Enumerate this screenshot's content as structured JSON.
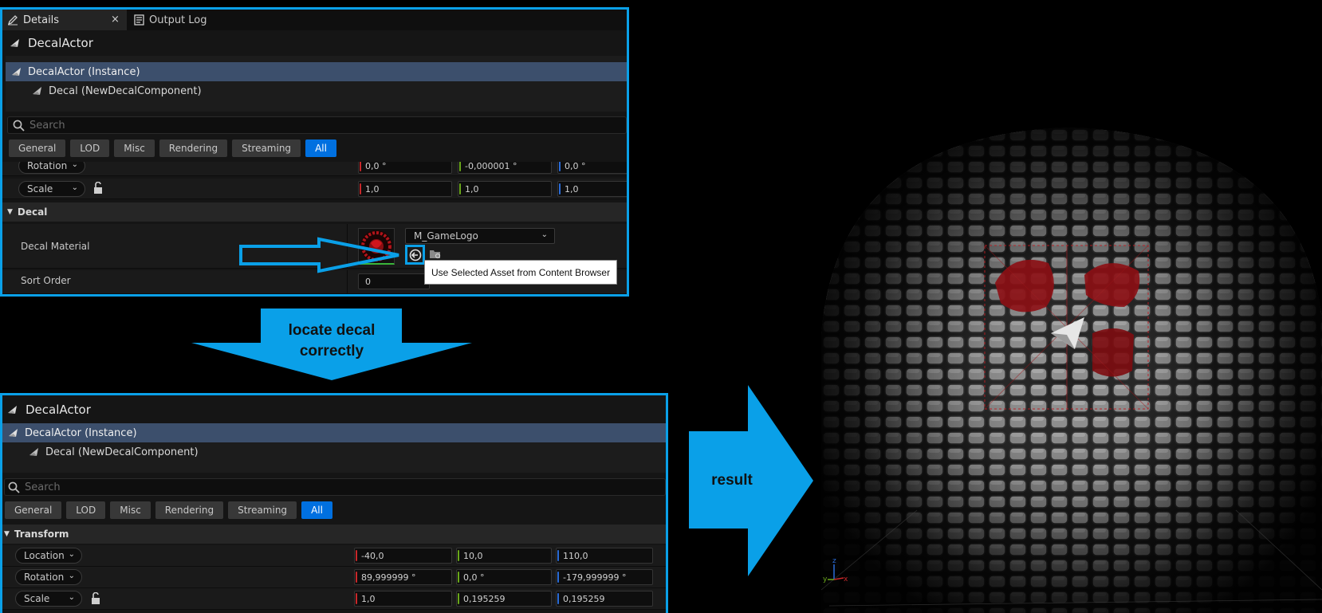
{
  "tabs": [
    {
      "label": "Details"
    },
    {
      "label": "Output Log"
    }
  ],
  "tab_close": "×",
  "panel1": {
    "actor_title": "DecalActor",
    "tree": [
      {
        "label": "DecalActor (Instance)"
      },
      {
        "label": "Decal (NewDecalComponent)"
      }
    ],
    "search_placeholder": "Search",
    "filters": [
      "General",
      "LOD",
      "Misc",
      "Rendering",
      "Streaming",
      "All"
    ],
    "rotation_label": "Rotation",
    "rotation_values": [
      "0,0 °",
      "-0,000001 °",
      "0,0 °"
    ],
    "scale_label": "Scale",
    "scale_values": [
      "1,0",
      "1,0",
      "1,0"
    ],
    "decal_section": "Decal",
    "decal_material_label": "Decal Material",
    "decal_material_value": "M_GameLogo",
    "sort_order_label": "Sort Order",
    "sort_order_value": "0"
  },
  "tooltip": "Use Selected Asset from Content Browser",
  "arrow1_label": "locate decal correctly",
  "arrow2_label": "result",
  "panel2": {
    "actor_title": "DecalActor",
    "tree": [
      {
        "label": "DecalActor (Instance)"
      },
      {
        "label": "Decal (NewDecalComponent)"
      }
    ],
    "search_placeholder": "Search",
    "filters": [
      "General",
      "LOD",
      "Misc",
      "Rendering",
      "Streaming",
      "All"
    ],
    "transform_section": "Transform",
    "location_label": "Location",
    "location_values": [
      "-40,0",
      "10,0",
      "110,0"
    ],
    "rotation_label": "Rotation",
    "rotation_values": [
      "89,999999 °",
      "0,0 °",
      "-179,999999 °"
    ],
    "scale_label": "Scale",
    "scale_values": [
      "1,0",
      "0,195259",
      "0,195259"
    ]
  },
  "viewport": {
    "gizmo_axes": [
      "z",
      "y",
      "x"
    ]
  },
  "colors": {
    "highlight_border": "#0aa0e8",
    "arrow_fill": "#0aa0e8",
    "selected_row": "#3c4f6c",
    "active_filter": "#0070e0",
    "axis_x": "#c8282a",
    "axis_y": "#6aa81a",
    "axis_z": "#2a6cd8"
  }
}
